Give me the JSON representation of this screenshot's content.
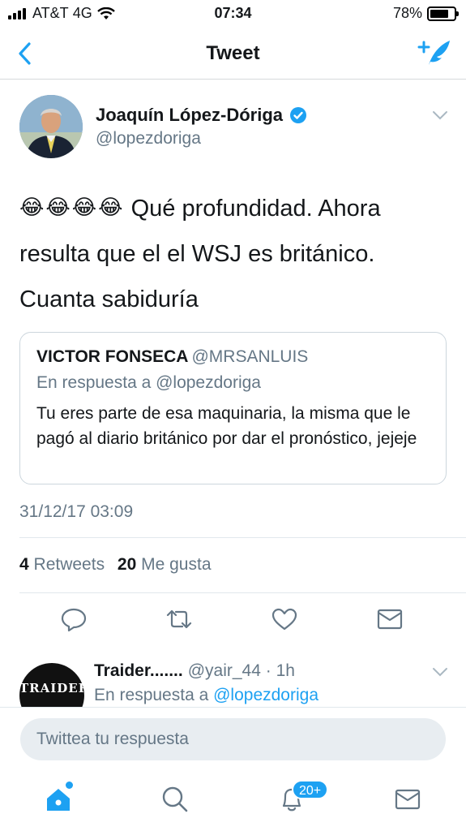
{
  "status_bar": {
    "carrier": "AT&T",
    "network": "4G",
    "time": "07:34",
    "battery_percent": "78%",
    "battery_level": 0.78
  },
  "nav": {
    "title": "Tweet",
    "icons": [
      "back-chevron-icon",
      "compose-tweet-icon"
    ]
  },
  "tweet": {
    "author_name": "Joaquín López-Dóriga",
    "author_handle": "@lopezdoriga",
    "verified": true,
    "emojis": [
      "😂",
      "😂",
      "😂",
      "😂"
    ],
    "text": "Qué profundidad. Ahora resulta que el el WSJ es británico. Cuanta sabiduría",
    "quote": {
      "name": "VICTOR FONSECA",
      "handle": "@MRSANLUIS",
      "reply_to": "En respuesta a @lopezdoriga",
      "text": "Tu eres parte de esa maquinaria, la misma que le pagó al diario británico por dar el pronóstico, jejeje"
    },
    "timestamp": "31/12/17 03:09",
    "stats": {
      "retweets_count": "4",
      "retweets_label": "Retweets",
      "likes_count": "20",
      "likes_label": "Me gusta"
    },
    "actions": [
      "reply-icon",
      "retweet-icon",
      "like-heart-icon",
      "direct-message-icon"
    ]
  },
  "reply": {
    "avatar_text": "TRAIDER",
    "name": "Traider.......",
    "handle": "@yair_44",
    "separator": "·",
    "age": "1h",
    "reply_prefix": "En respuesta a",
    "reply_mention": "@lopezdoriga"
  },
  "composer": {
    "placeholder": "Twittea tu respuesta"
  },
  "tab_bar": {
    "notifications_badge": "20+",
    "tabs": [
      "home-icon",
      "search-icon",
      "notifications-bell-icon",
      "messages-icon"
    ]
  },
  "colors": {
    "accent": "#1da1f2",
    "secondary_text": "#657786",
    "primary_text": "#14171a"
  }
}
